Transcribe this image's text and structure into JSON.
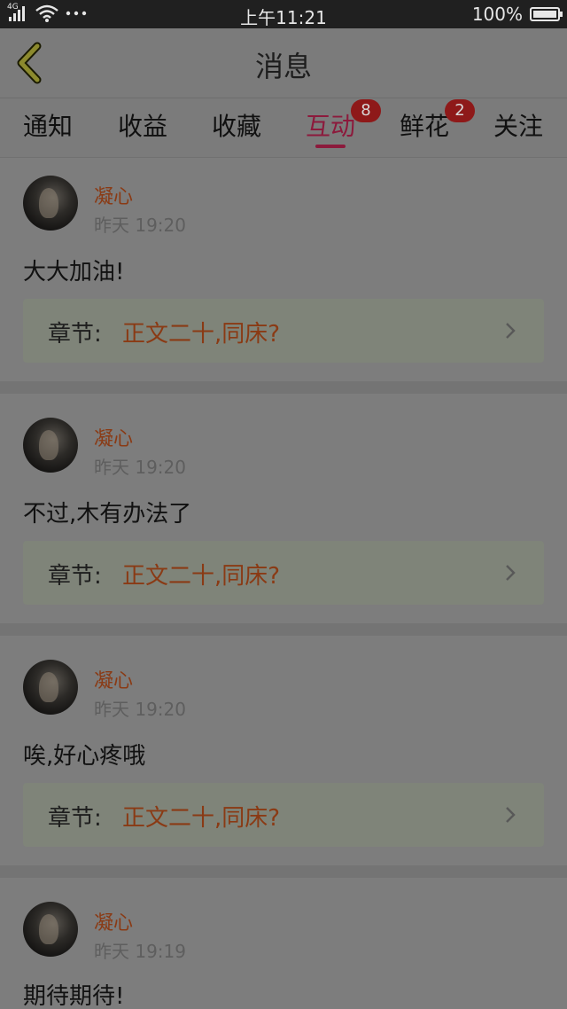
{
  "status_bar": {
    "network": "4G",
    "time": "上午11:21",
    "battery": "100%",
    "battery_level": 1.0
  },
  "nav": {
    "title": "消息"
  },
  "tabs": [
    {
      "label": "通知",
      "badge": ""
    },
    {
      "label": "收益",
      "badge": ""
    },
    {
      "label": "收藏",
      "badge": ""
    },
    {
      "label": "互动",
      "badge": "8",
      "active": true
    },
    {
      "label": "鲜花",
      "badge": "2"
    },
    {
      "label": "关注",
      "badge": ""
    }
  ],
  "messages": [
    {
      "user": "凝心",
      "time": "昨天 19:20",
      "text": "大大加油!",
      "chapter_label": "章节:",
      "chapter_title": "正文二十,同床?"
    },
    {
      "user": "凝心",
      "time": "昨天 19:20",
      "text": "不过,木有办法了",
      "chapter_label": "章节:",
      "chapter_title": "正文二十,同床?"
    },
    {
      "user": "凝心",
      "time": "昨天 19:20",
      "text": "唉,好心疼哦",
      "chapter_label": "章节:",
      "chapter_title": "正文二十,同床?"
    },
    {
      "user": "凝心",
      "time": "昨天 19:19",
      "text": "期待期待!",
      "chapter_label": "",
      "chapter_title": ""
    }
  ],
  "colors": {
    "accent": "#8c1a3c",
    "username": "#8a3a14",
    "badge": "#8e1919"
  }
}
